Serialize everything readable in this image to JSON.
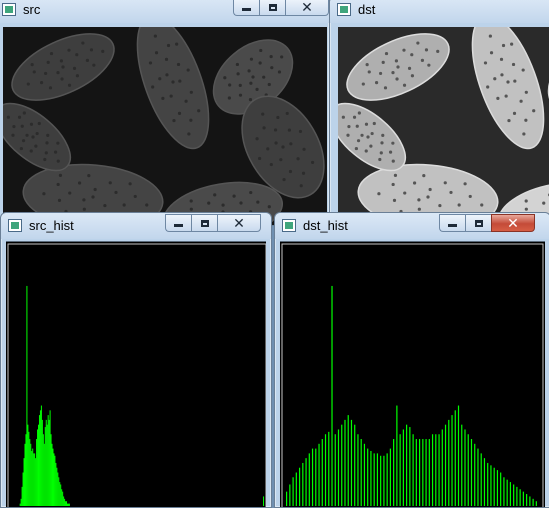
{
  "windows": {
    "src": {
      "title": "src"
    },
    "dst": {
      "title": "dst"
    },
    "src_hist": {
      "title": "src_hist"
    },
    "dst_hist": {
      "title": "dst_hist"
    }
  },
  "controls": {
    "minimize": "minimize-icon",
    "maximize": "maximize-icon",
    "close": "close-icon",
    "close_glyph": "✕"
  },
  "colors": {
    "histogram_bar": "#00ff00",
    "histogram_background": "#000000",
    "close_active": "#c44b38"
  },
  "images": {
    "src_brightness": 0.35,
    "dst_brightness": 1.0
  },
  "chart_data": [
    {
      "type": "bar",
      "name": "src_hist",
      "x": [
        0,
        255
      ],
      "ylim": [
        0,
        100
      ],
      "bins_description": "intensity histogram",
      "values": [
        0,
        0,
        0,
        0,
        0,
        0,
        0,
        0,
        0,
        0,
        1,
        3,
        8,
        14,
        20,
        26,
        30,
        92,
        34,
        31,
        28,
        26,
        23,
        24,
        22,
        22,
        20,
        28,
        32,
        34,
        38,
        40,
        42,
        36,
        30,
        26,
        33,
        36,
        34,
        38,
        36,
        40,
        30,
        26,
        24,
        22,
        21,
        18,
        16,
        14,
        12,
        10,
        9,
        7,
        6,
        4,
        3,
        2,
        2,
        1,
        1,
        1,
        0,
        0,
        0,
        0,
        0,
        0,
        0,
        0,
        0,
        0,
        0,
        0,
        0,
        0,
        0,
        0,
        0,
        0,
        0,
        0,
        0,
        0,
        0,
        0,
        0,
        0,
        0,
        0,
        0,
        0,
        0,
        0,
        0,
        0,
        0,
        0,
        0,
        0,
        0,
        0,
        0,
        0,
        0,
        0,
        0,
        0,
        0,
        0,
        0,
        0,
        0,
        0,
        0,
        0,
        0,
        0,
        0,
        0,
        0,
        0,
        0,
        0,
        0,
        0,
        0,
        0,
        0,
        0,
        0,
        0,
        0,
        0,
        0,
        0,
        0,
        0,
        0,
        0,
        0,
        0,
        0,
        0,
        0,
        0,
        0,
        0,
        0,
        0,
        0,
        0,
        0,
        0,
        0,
        0,
        0,
        0,
        0,
        0,
        0,
        0,
        0,
        0,
        0,
        0,
        0,
        0,
        0,
        0,
        0,
        0,
        0,
        0,
        0,
        0,
        0,
        0,
        0,
        0,
        0,
        0,
        0,
        0,
        0,
        0,
        0,
        0,
        0,
        0,
        0,
        0,
        0,
        0,
        0,
        0,
        0,
        0,
        0,
        0,
        0,
        0,
        0,
        0,
        0,
        0,
        0,
        0,
        0,
        0,
        0,
        0,
        0,
        0,
        0,
        0,
        0,
        0,
        0,
        0,
        0,
        0,
        0,
        0,
        0,
        0,
        0,
        0,
        0,
        0,
        0,
        0,
        0,
        0,
        0,
        0,
        0,
        0,
        0,
        0,
        0,
        0,
        0,
        0,
        0,
        0,
        0,
        0,
        0,
        0,
        0,
        0,
        0,
        0,
        0,
        0,
        0,
        0,
        0,
        0,
        0,
        0,
        4
      ]
    },
    {
      "type": "bar",
      "name": "dst_hist",
      "x": [
        0,
        255
      ],
      "ylim": [
        0,
        100
      ],
      "bins_description": "intensity histogram",
      "values": [
        6,
        9,
        12,
        14,
        16,
        18,
        20,
        22,
        24,
        24,
        26,
        28,
        30,
        31,
        92,
        30,
        32,
        34,
        36,
        38,
        36,
        34,
        30,
        28,
        26,
        24,
        23,
        22,
        22,
        21,
        21,
        22,
        24,
        28,
        42,
        30,
        32,
        34,
        33,
        30,
        28,
        28,
        28,
        28,
        28,
        30,
        30,
        30,
        32,
        34,
        36,
        38,
        40,
        42,
        34,
        32,
        30,
        28,
        26,
        24,
        22,
        20,
        18,
        17,
        16,
        15,
        14,
        12,
        11,
        10,
        9,
        8,
        7,
        6,
        5,
        4,
        3,
        2
      ]
    }
  ]
}
